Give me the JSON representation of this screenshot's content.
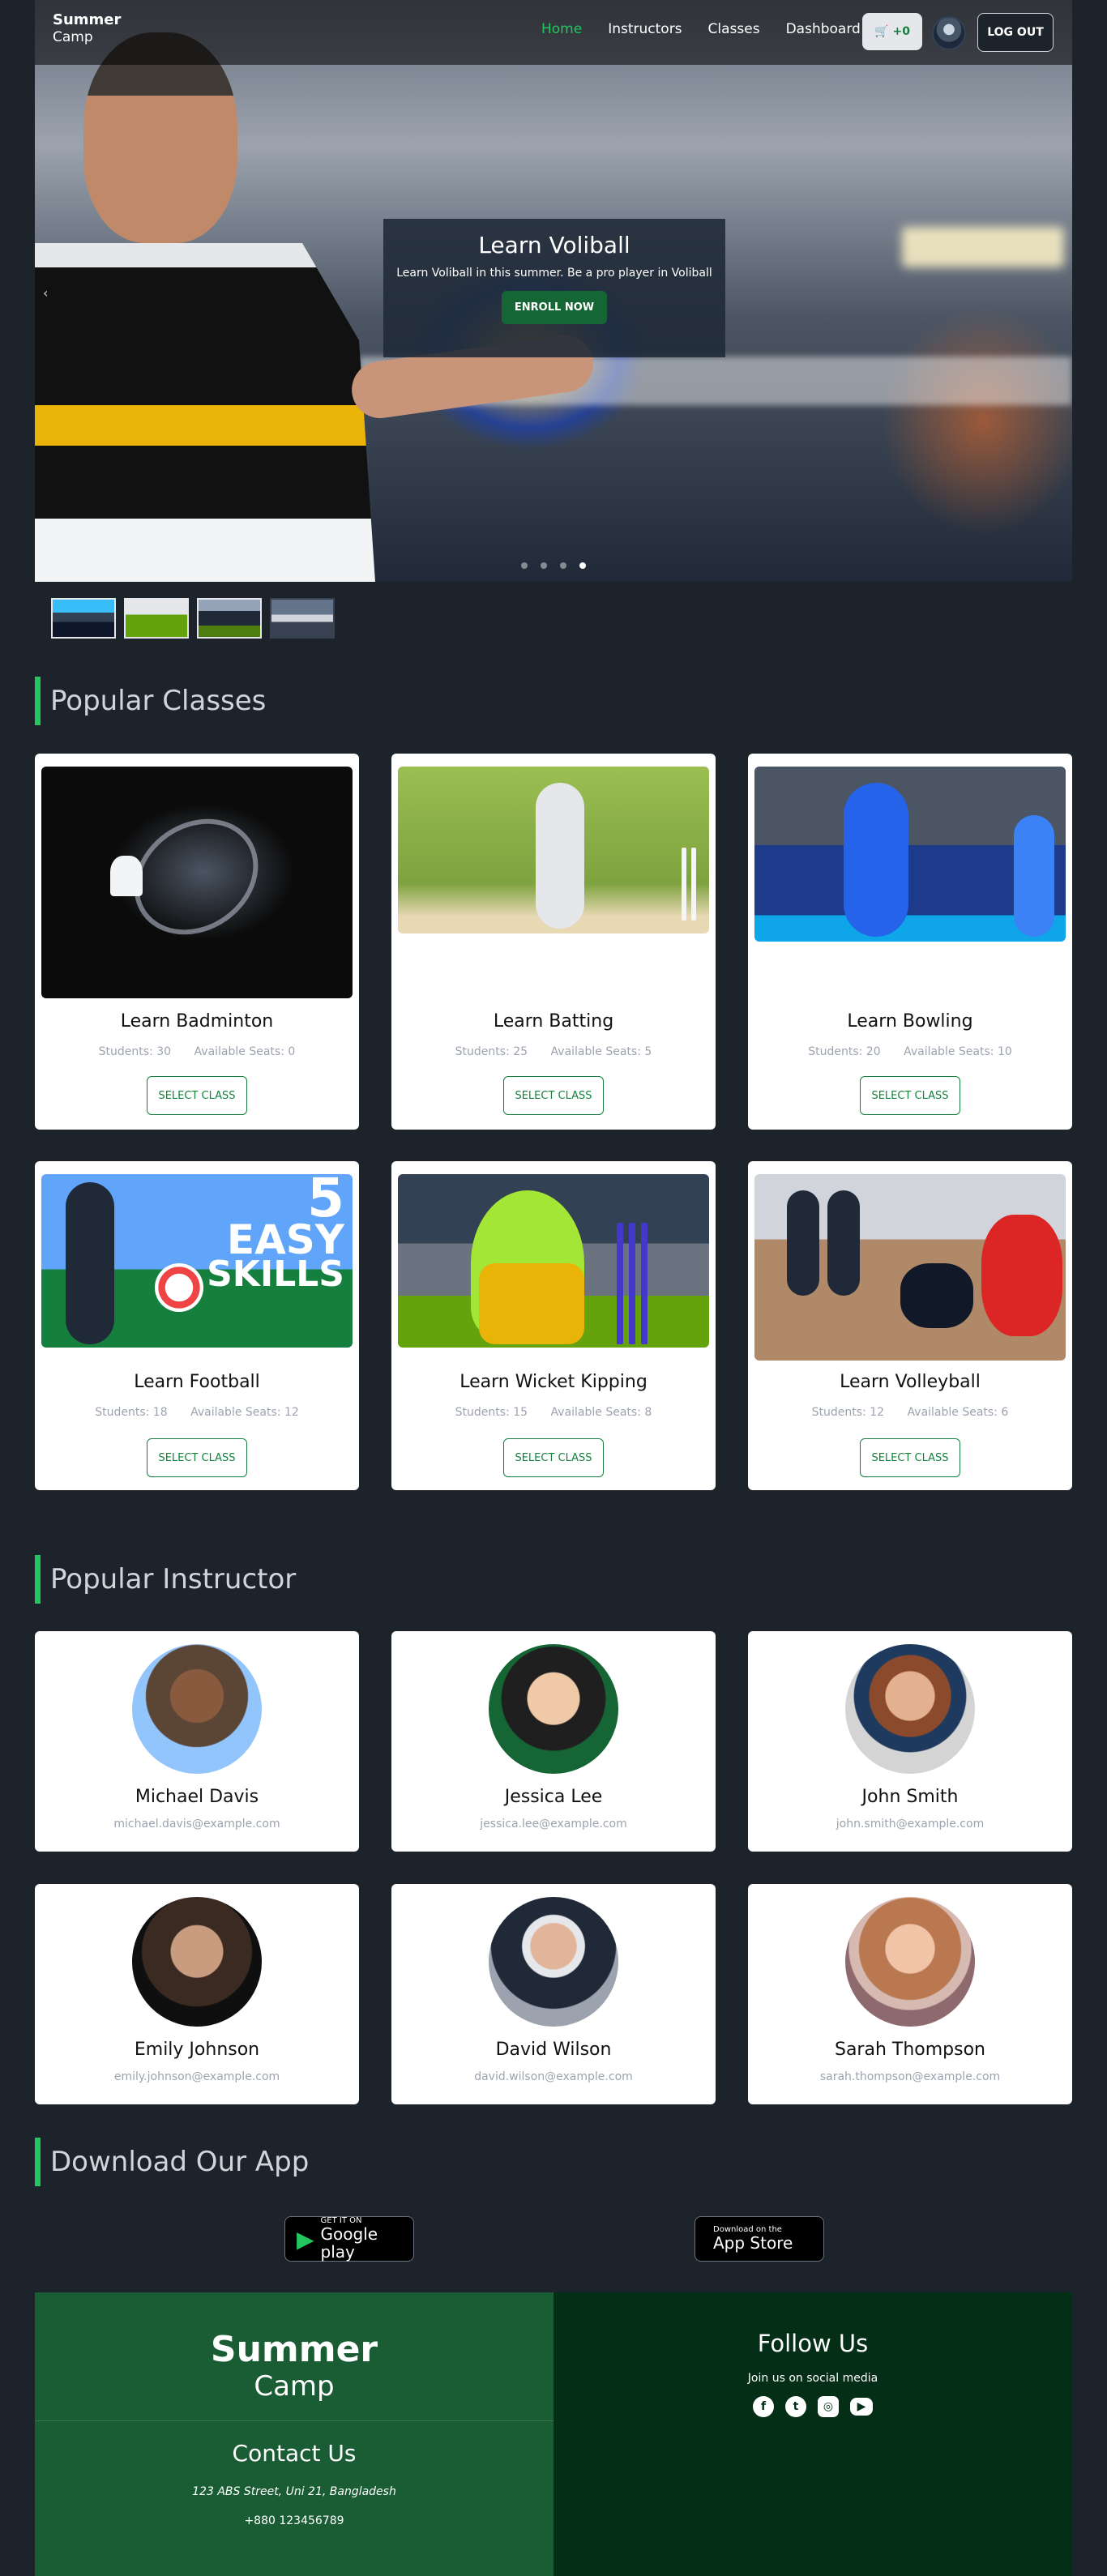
{
  "nav": {
    "brand_line1": "Summer",
    "brand_line2": "Camp",
    "links": [
      "Home",
      "Instructors",
      "Classes",
      "Dashboard"
    ],
    "cart_label": "+0",
    "logout_label": "LOG OUT",
    "accent_color": "#22c55e"
  },
  "hero": {
    "title": "Learn Voliball",
    "text": "Learn Voliball in this summer. Be a pro player in Voliball",
    "cta": "ENROLL NOW",
    "prev_icon": "‹",
    "slides": 4,
    "active_slide": 4
  },
  "popular_classes": {
    "title": "Popular Classes",
    "select_label": "SELECT CLASS",
    "students_prefix": "Students:",
    "seats_prefix": "Available Seats:",
    "items": [
      {
        "name": "Learn Badminton",
        "students": "30",
        "seats": "0"
      },
      {
        "name": "Learn Batting",
        "students": "25",
        "seats": "5"
      },
      {
        "name": "Learn Bowling",
        "students": "20",
        "seats": "10"
      },
      {
        "name": "Learn Football",
        "students": "18",
        "seats": "12"
      },
      {
        "name": "Learn Wicket Kipping",
        "students": "15",
        "seats": "8"
      },
      {
        "name": "Learn Volleyball",
        "students": "12",
        "seats": "6"
      }
    ],
    "football_overlay": [
      "5",
      "EASY",
      "SKILLS"
    ]
  },
  "popular_instructors": {
    "title": "Popular Instructor",
    "items": [
      {
        "name": "Michael Davis",
        "email": "michael.davis@example.com"
      },
      {
        "name": "Jessica Lee",
        "email": "jessica.lee@example.com"
      },
      {
        "name": "John Smith",
        "email": "john.smith@example.com"
      },
      {
        "name": "Emily Johnson",
        "email": "emily.johnson@example.com"
      },
      {
        "name": "David Wilson",
        "email": "david.wilson@example.com"
      },
      {
        "name": "Sarah Thompson",
        "email": "sarah.thompson@example.com"
      }
    ]
  },
  "download": {
    "title": "Download Our App",
    "google_small": "GET IT ON",
    "google_big": "Google play",
    "apple_small": "Download on the",
    "apple_big": "App Store"
  },
  "footer": {
    "logo_line1": "Summer",
    "logo_line2": "Camp",
    "contact_title": "Contact Us",
    "address": "123 ABS Street, Uni 21, Bangladesh",
    "phone": "+880 123456789",
    "follow_title": "Follow Us",
    "follow_text": "Join us on social media",
    "social": [
      "facebook-icon",
      "twitter-icon",
      "instagram-icon",
      "youtube-icon"
    ]
  }
}
